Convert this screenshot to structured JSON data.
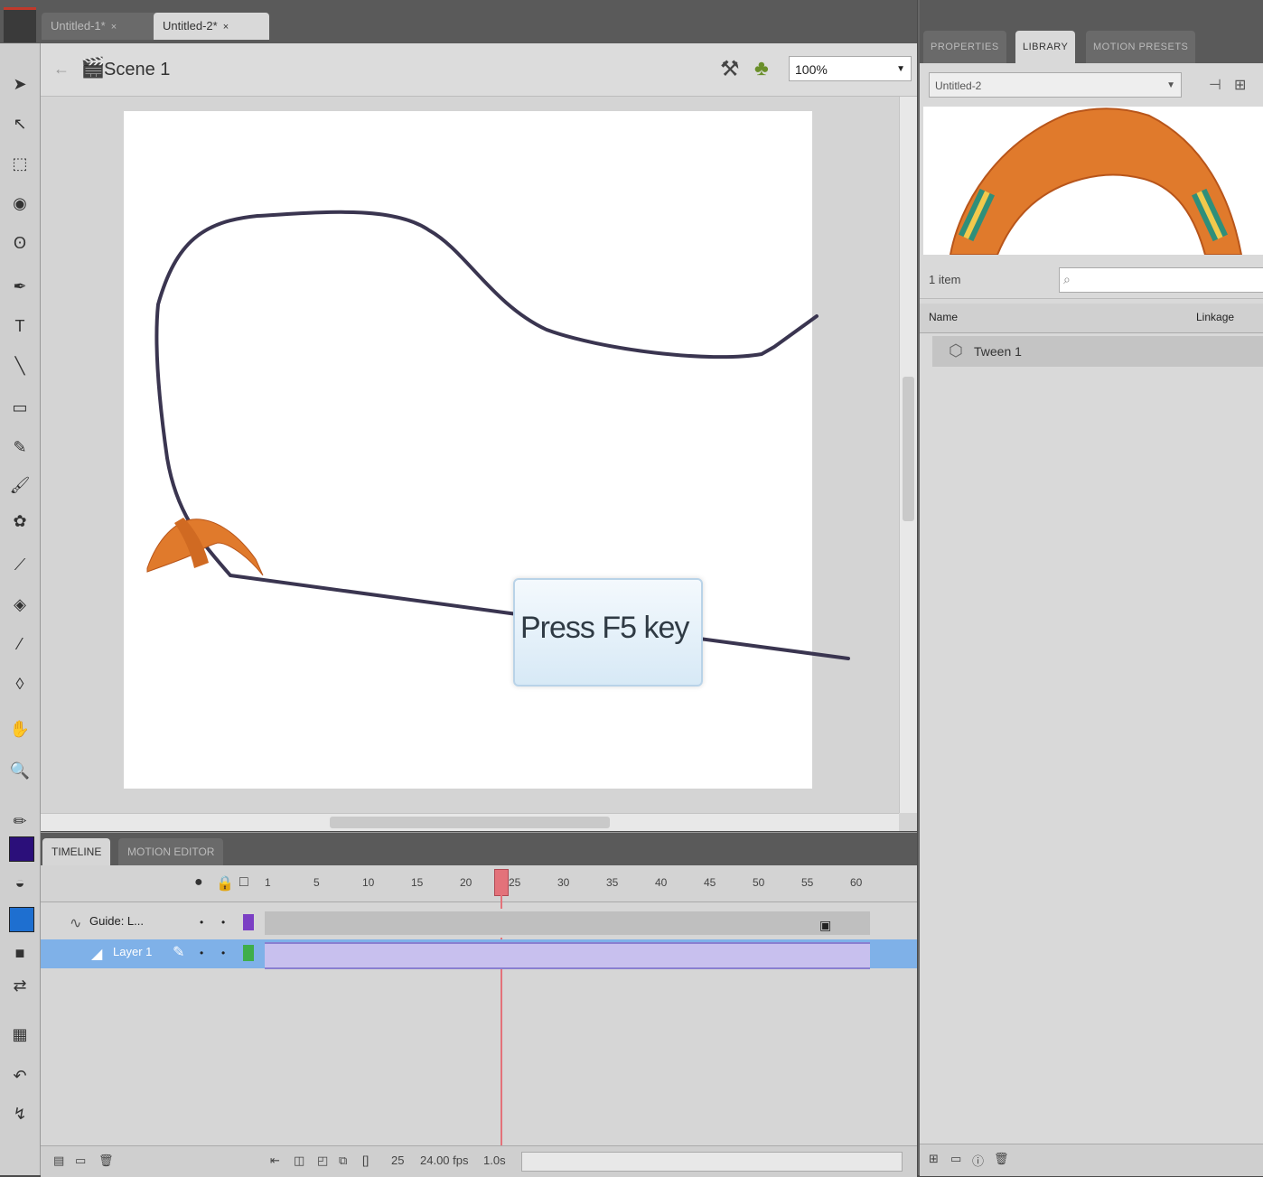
{
  "doc_tabs": [
    {
      "label": "Untitled-1*",
      "close": "×"
    },
    {
      "label": "Untitled-2*",
      "close": "×"
    }
  ],
  "edit_bar": {
    "scene_label": "Scene 1",
    "zoom": "100%"
  },
  "stage": {
    "callout_text": "Press F5 key"
  },
  "colors": {
    "stroke_swatch": "#2b0f7a",
    "fill_swatch": "#1e6fd0",
    "boomerang": "#e07a2c",
    "path": "#3a3550",
    "playhead": "#e3727a"
  },
  "timeline": {
    "tabs": [
      "TIMELINE",
      "MOTION EDITOR"
    ],
    "header_icons": [
      "eye-icon",
      "lock-icon",
      "outline-icon"
    ],
    "frame_numbers": [
      "1",
      "5",
      "10",
      "15",
      "20",
      "25",
      "30",
      "35",
      "40",
      "45",
      "50",
      "55",
      "60"
    ],
    "layers": [
      {
        "name": "Guide: L...",
        "selected": false,
        "color": "#7b3fc4"
      },
      {
        "name": "Layer 1",
        "selected": true,
        "color": "#3fae4a"
      }
    ],
    "current_frame": 25,
    "fps": "24.00 fps",
    "elapsed": "1.0s"
  },
  "right_panel": {
    "tabs": [
      "PROPERTIES",
      "LIBRARY",
      "MOTION PRESETS"
    ],
    "library_select": "Untitled-2",
    "item_count": "1 item",
    "columns": {
      "name": "Name",
      "linkage": "Linkage"
    },
    "items": [
      {
        "name": "Tween 1"
      }
    ]
  }
}
